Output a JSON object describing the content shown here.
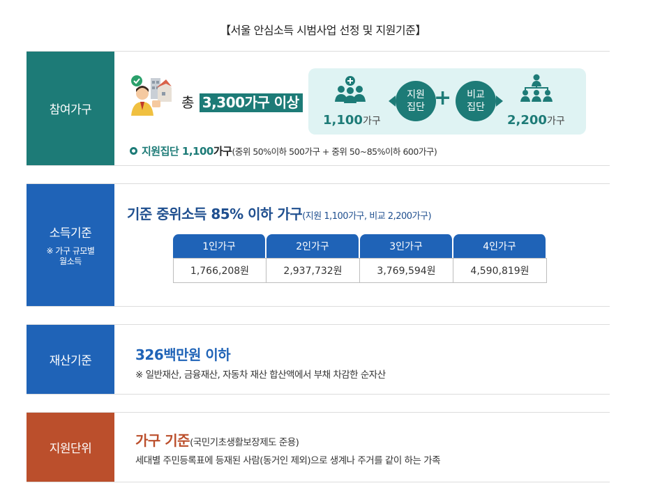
{
  "title": "【서울 안심소득 시범사업 선정 및 지원기준】",
  "participants": {
    "label": "참여가구",
    "total_prefix": "총",
    "total_highlight": "3,300가구 이상",
    "support_group": {
      "count": "1,100",
      "unit": "가구",
      "circle": "지원\n집단",
      "icon": "group-plus-icon"
    },
    "compare_group": {
      "count": "2,200",
      "unit": "가구",
      "circle": "비교\n집단",
      "icon": "group-hierarchy-icon"
    },
    "plus_sign": "+",
    "detail_label": "지원집단 1,100",
    "detail_unit": "가구",
    "detail_paren": "(중위 50%이하 500가구 + 중위 50~85%이하 600가구)"
  },
  "income": {
    "label": "소득기준",
    "note": "※ 가구 규모별\n월소득",
    "title": "기준 중위소득 85% 이하 가구",
    "title_paren": "(지원 1,100가구, 비교 2,200가구)",
    "headers": [
      "1인가구",
      "2인가구",
      "3인가구",
      "4인가구"
    ],
    "values": [
      "1,766,208원",
      "2,937,732원",
      "3,769,594원",
      "4,590,819원"
    ]
  },
  "assets": {
    "label": "재산기준",
    "title": "326백만원 이하",
    "note": "※ 일반재산, 금융재산, 자동차 재산 합산액에서 부채 차감한 순자산"
  },
  "unit": {
    "label": "지원단위",
    "title": "가구 기준",
    "title_paren": "(국민기초생활보장제도 준용)",
    "note": "세대별 주민등록표에 등재된 사람(동거인 제외)으로 생계나 주거를 같이 하는 가족"
  },
  "colors": {
    "teal": "#1d7b77",
    "blue": "#1f63b7",
    "orange": "#bb4f2c",
    "light_teal": "#dff3f3"
  }
}
